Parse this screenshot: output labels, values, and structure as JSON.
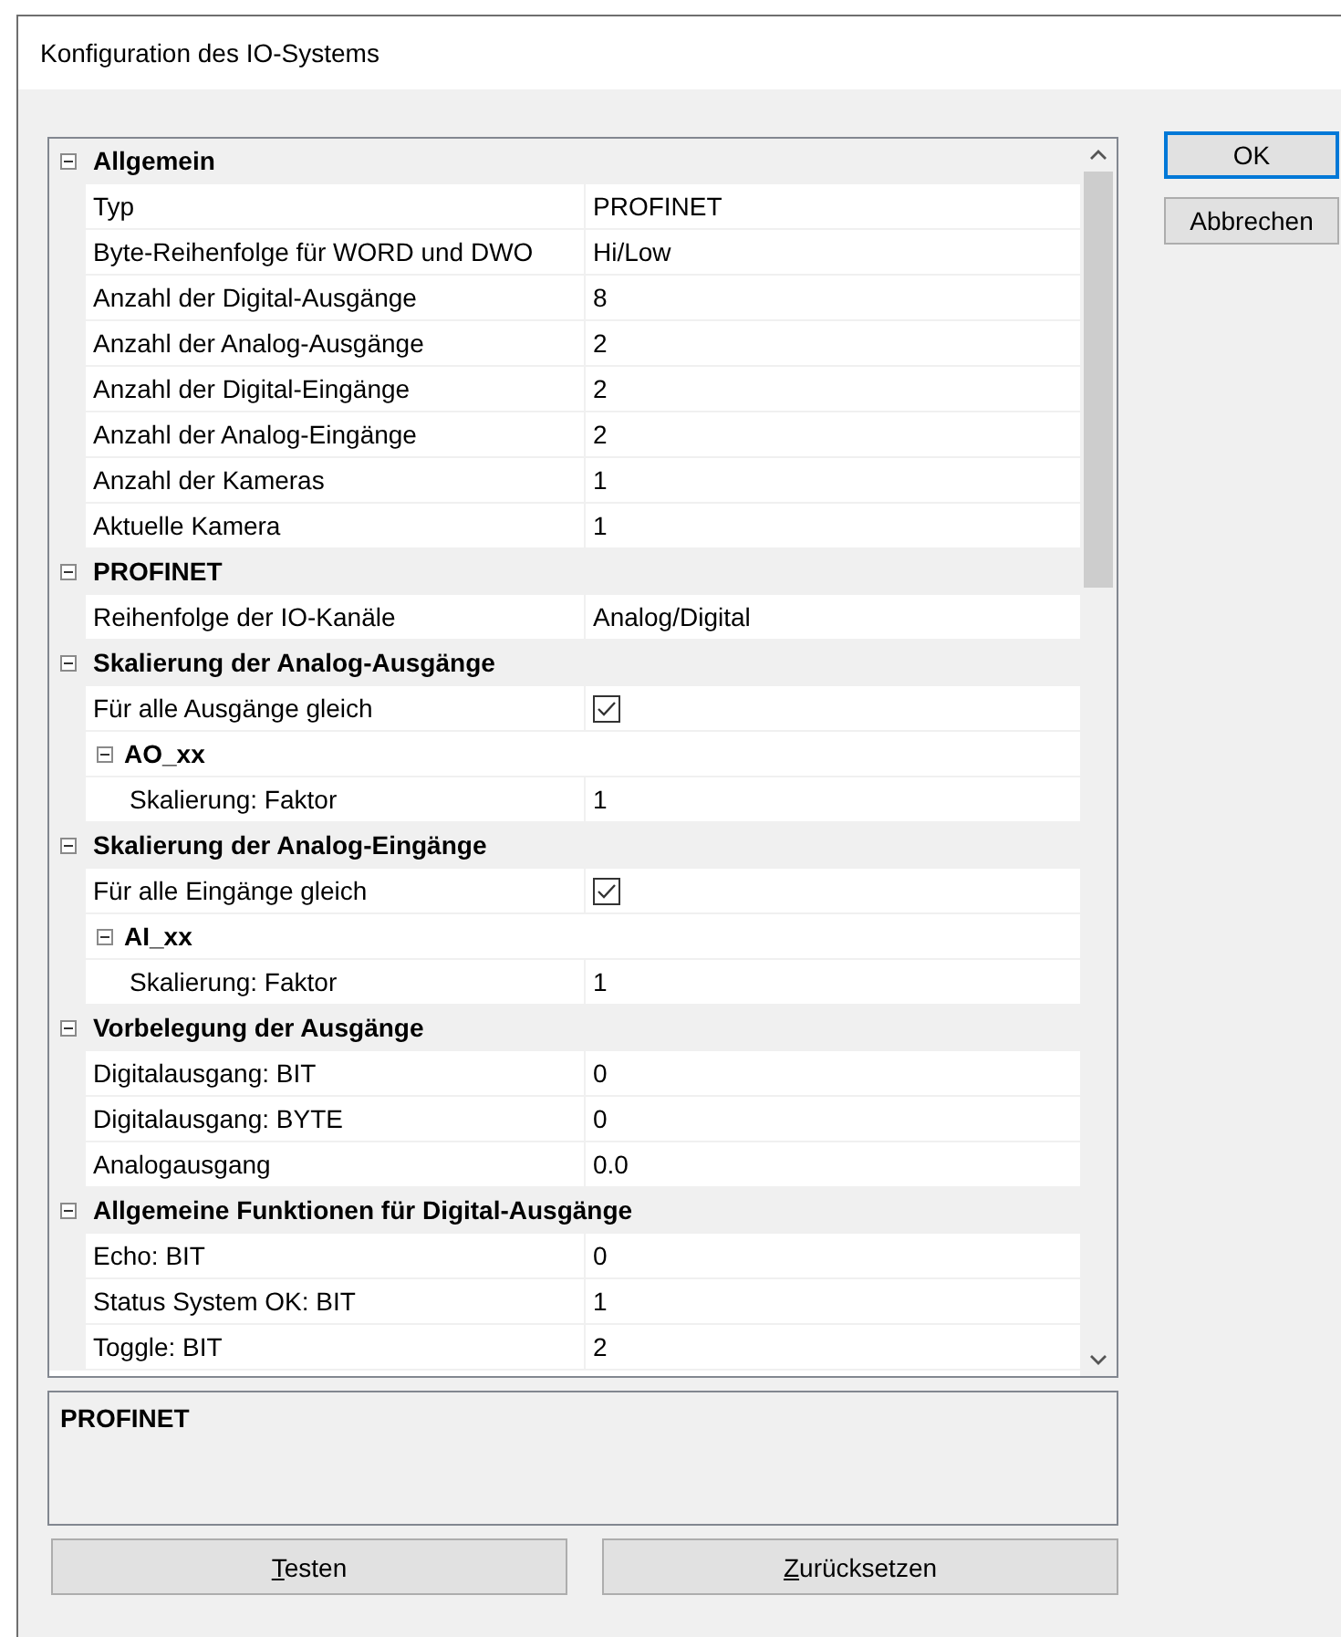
{
  "window": {
    "title": "Konfiguration des IO-Systems"
  },
  "property_grid": {
    "categories": [
      {
        "label": "Allgemein",
        "expanded": true,
        "children": [
          {
            "kind": "text",
            "name": "Typ",
            "value": "PROFINET"
          },
          {
            "kind": "text",
            "name": "Byte-Reihenfolge für WORD und DWO",
            "value": "Hi/Low"
          },
          {
            "kind": "text",
            "name": "Anzahl der Digital-Ausgänge",
            "value": "8"
          },
          {
            "kind": "text",
            "name": "Anzahl der Analog-Ausgänge",
            "value": "2"
          },
          {
            "kind": "text",
            "name": "Anzahl der Digital-Eingänge",
            "value": "2"
          },
          {
            "kind": "text",
            "name": "Anzahl der Analog-Eingänge",
            "value": "2"
          },
          {
            "kind": "text",
            "name": "Anzahl der Kameras",
            "value": "1"
          },
          {
            "kind": "text",
            "name": "Aktuelle Kamera",
            "value": "1"
          }
        ]
      },
      {
        "label": "PROFINET",
        "expanded": true,
        "children": [
          {
            "kind": "text",
            "name": "Reihenfolge der IO-Kanäle",
            "value": "Analog/Digital"
          }
        ]
      },
      {
        "label": "Skalierung der Analog-Ausgänge",
        "expanded": true,
        "children": [
          {
            "kind": "checkbox",
            "name": "Für alle Ausgänge gleich",
            "checked": true
          },
          {
            "kind": "group",
            "label": "AO_xx",
            "expanded": true,
            "children": [
              {
                "kind": "text",
                "name": "Skalierung: Faktor",
                "value": "1"
              }
            ]
          }
        ]
      },
      {
        "label": "Skalierung der Analog-Eingänge",
        "expanded": true,
        "children": [
          {
            "kind": "checkbox",
            "name": "Für alle Eingänge gleich",
            "checked": true
          },
          {
            "kind": "group",
            "label": "AI_xx",
            "expanded": true,
            "children": [
              {
                "kind": "text",
                "name": "Skalierung: Faktor",
                "value": "1"
              }
            ]
          }
        ]
      },
      {
        "label": "Vorbelegung der Ausgänge",
        "expanded": true,
        "children": [
          {
            "kind": "text",
            "name": "Digitalausgang: BIT",
            "value": "0"
          },
          {
            "kind": "text",
            "name": "Digitalausgang: BYTE",
            "value": "0"
          },
          {
            "kind": "text",
            "name": "Analogausgang",
            "value": "0.0"
          }
        ]
      },
      {
        "label": "Allgemeine Funktionen für Digital-Ausgänge",
        "expanded": true,
        "children": [
          {
            "kind": "text",
            "name": "Echo: BIT",
            "value": "0"
          },
          {
            "kind": "text",
            "name": "Status System OK: BIT",
            "value": "1"
          },
          {
            "kind": "text",
            "name": "Toggle: BIT",
            "value": "2"
          }
        ]
      }
    ]
  },
  "description": {
    "title": "PROFINET"
  },
  "side_buttons": [
    {
      "label": "OK",
      "default": true
    },
    {
      "label": "Abbrechen",
      "default": false
    }
  ],
  "bottom_buttons": [
    {
      "label": "Testen",
      "access_key_underlined": true
    },
    {
      "label": "Zurücksetzen",
      "access_key_underlined": true
    }
  ]
}
